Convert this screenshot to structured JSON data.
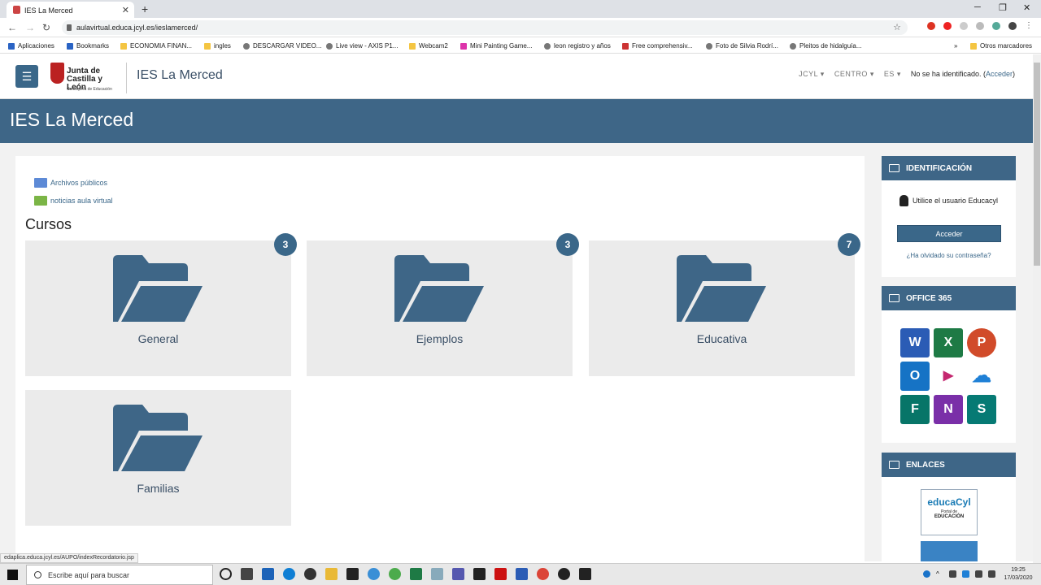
{
  "browser": {
    "tab_title": "IES La Merced",
    "url": "aulavirtual.educa.jcyl.es/ieslamerced/",
    "bookmarks": [
      "Aplicaciones",
      "Bookmarks",
      "ECONOMIA FINAN...",
      "ingles",
      "DESCARGAR VIDEO...",
      "Live view - AXIS P1...",
      "Webcam2",
      "Mini Painting Game...",
      "leon registro y años",
      "Free comprehensiv...",
      "Foto de Silvia Rodrí...",
      "Pleitos de hidalguía..."
    ],
    "other_bookmarks": "Otros marcadores",
    "status_url": "edaplica.educa.jcyl.es/AUPO/indexRecordatorio.jsp"
  },
  "header": {
    "logo_text": "Junta de Castilla y León",
    "logo_sub": "Consejería de Educación",
    "site_title": "IES La Merced",
    "nav": [
      "JCYL",
      "CENTRO",
      "ES"
    ],
    "user_text": "No se ha identificado. (",
    "login_link": "Acceder",
    "user_close": ")"
  },
  "banner": {
    "title": "IES La Merced"
  },
  "links": {
    "archivos": "Archivos públicos",
    "noticias": "noticias aula virtual"
  },
  "cursos_title": "Cursos",
  "courses": [
    {
      "name": "General",
      "count": "3"
    },
    {
      "name": "Ejemplos",
      "count": "3"
    },
    {
      "name": "Educativa",
      "count": "7"
    },
    {
      "name": "Familias",
      "count": ""
    }
  ],
  "sidebar": {
    "ident_title": "IDENTIFICACIÓN",
    "ident_text": "Utilice el usuario Educacyl",
    "acceder": "Acceder",
    "forgot": "¿Ha olvidado su contraseña?",
    "office_title": "OFFICE 365",
    "apps": [
      "W",
      "X",
      "P",
      "O",
      "▶",
      "☁",
      "F",
      "N",
      "S"
    ],
    "enlaces_title": "ENLACES",
    "educa_logo": "educaCyl",
    "educa_sub1": "Portal de",
    "educa_sub2": "EDUCACIÓN"
  },
  "taskbar": {
    "search": "Escribe aquí para buscar",
    "time": "19:25",
    "date": "17/03/2020"
  },
  "colors": {
    "primary": "#3e6687",
    "accent": "#3a6789"
  }
}
